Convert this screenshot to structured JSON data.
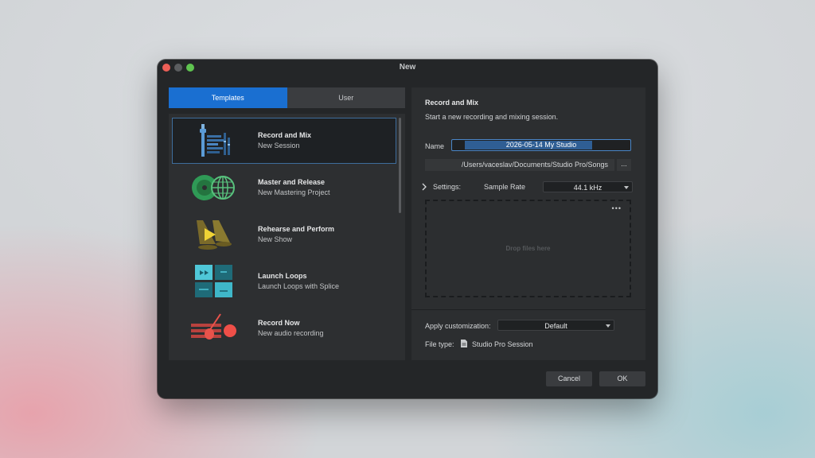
{
  "window": {
    "title": "New"
  },
  "tabs": [
    {
      "label": "Templates",
      "active": true
    },
    {
      "label": "User",
      "active": false
    }
  ],
  "templates": [
    {
      "name": "Record and Mix",
      "desc": "New Session",
      "icon": "record-mix-icon",
      "selected": true
    },
    {
      "name": "Master and Release",
      "desc": "New Mastering Project",
      "icon": "master-release-icon",
      "selected": false
    },
    {
      "name": "Rehearse and Perform",
      "desc": "New Show",
      "icon": "rehearse-perform-icon",
      "selected": false
    },
    {
      "name": "Launch Loops",
      "desc": "Launch Loops with Splice",
      "icon": "launch-loops-icon",
      "selected": false
    },
    {
      "name": "Record Now",
      "desc": "New audio recording",
      "icon": "record-now-icon",
      "selected": false
    }
  ],
  "details": {
    "title": "Record and Mix",
    "subtitle": "Start a new recording and mixing session.",
    "name_label": "Name",
    "name_value": "2026-05-14 My Studio",
    "path": "/Users/vaceslav/Documents/Studio Pro/Songs",
    "browse": "...",
    "settings_label": "Settings:",
    "sample_rate_label": "Sample Rate",
    "sample_rate_value": "44.1 kHz",
    "drop_text": "Drop files here",
    "more": "•••",
    "customization_label": "Apply customization:",
    "customization_value": "Default",
    "file_type_label": "File type:",
    "file_type_value": "Studio Pro Session"
  },
  "buttons": {
    "cancel": "Cancel",
    "ok": "OK"
  },
  "colors": {
    "accent": "#1a6fd1",
    "background": "#242628",
    "panel": "#2c2e30"
  }
}
